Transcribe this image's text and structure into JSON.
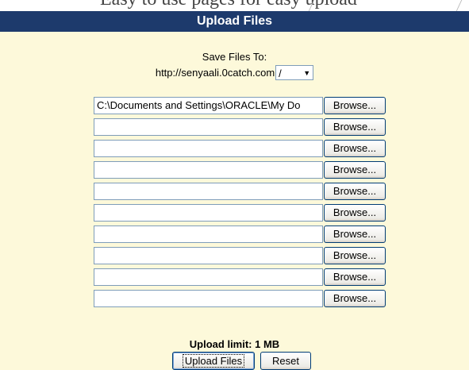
{
  "top_cut_text": "Easy to use pages for easy upload",
  "panel": {
    "title": "Upload Files",
    "save_to_label": "Save Files To:",
    "host": "http://senyaali.0catch.com",
    "folder_selected": "/"
  },
  "file_rows": [
    {
      "value": "C:\\Documents and Settings\\ORACLE\\My Do",
      "browse_label": "Browse..."
    },
    {
      "value": "",
      "browse_label": "Browse..."
    },
    {
      "value": "",
      "browse_label": "Browse..."
    },
    {
      "value": "",
      "browse_label": "Browse..."
    },
    {
      "value": "",
      "browse_label": "Browse..."
    },
    {
      "value": "",
      "browse_label": "Browse..."
    },
    {
      "value": "",
      "browse_label": "Browse..."
    },
    {
      "value": "",
      "browse_label": "Browse..."
    },
    {
      "value": "",
      "browse_label": "Browse..."
    },
    {
      "value": "",
      "browse_label": "Browse..."
    }
  ],
  "footer": {
    "upload_limit": "Upload limit: 1 MB",
    "upload_button": "Upload Files",
    "reset_button": "Reset"
  },
  "colors": {
    "title_bar": "#1d3a6c",
    "panel_background": "#fdf9da",
    "button_border": "#003c74"
  },
  "icons": {
    "dropdown": "chevron-down-icon"
  }
}
